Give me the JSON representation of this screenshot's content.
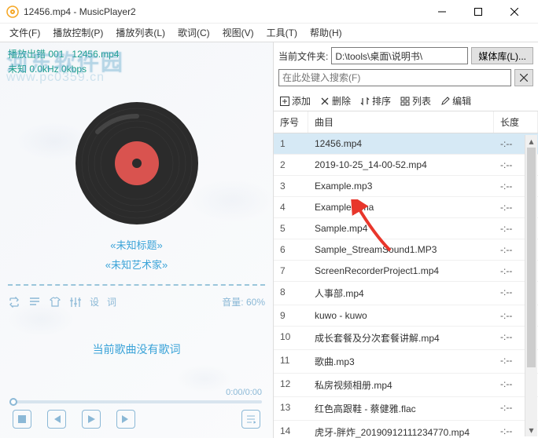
{
  "titlebar": {
    "title": "12456.mp4 - MusicPlayer2"
  },
  "menubar": [
    "文件(F)",
    "播放控制(P)",
    "播放列表(L)",
    "歌词(C)",
    "视图(V)",
    "工具(T)",
    "帮助(H)"
  ],
  "watermark": {
    "main": "河东软件园",
    "url": "www.pc0359.cn"
  },
  "nowplaying": {
    "line1_prefix": "播放出错",
    "line1_num": "001",
    "line1_file": "12456.mp4",
    "line2": "未知 0.0kHz 0kbps"
  },
  "track": {
    "title": "«未知标题»",
    "artist": "«未知艺术家»"
  },
  "controls": {
    "settings_label": "设",
    "lyrics_label": "词",
    "volume_label": "音量:",
    "volume_value": "60%"
  },
  "lyrics_text": "当前歌曲没有歌词",
  "time": {
    "elapsed": "0:00",
    "total": "0:00"
  },
  "right": {
    "current_folder_label": "当前文件夹:",
    "path_value": "D:\\tools\\桌面\\说明书\\",
    "media_lib_btn": "媒体库(L)...",
    "search_placeholder": "在此处键入搜索(F)",
    "toolbar": {
      "add": "添加",
      "delete": "删除",
      "sort": "排序",
      "list": "列表",
      "edit": "编辑"
    },
    "headers": {
      "num": "序号",
      "track": "曲目",
      "len": "长度"
    },
    "rows": [
      {
        "n": "1",
        "t": "12456.mp4",
        "l": "-:--",
        "sel": true
      },
      {
        "n": "2",
        "t": "2019-10-25_14-00-52.mp4",
        "l": "-:--"
      },
      {
        "n": "3",
        "t": "Example.mp3",
        "l": "-:--"
      },
      {
        "n": "4",
        "t": "Example.wma",
        "l": "-:--"
      },
      {
        "n": "5",
        "t": "Sample.mp4",
        "l": "-:--"
      },
      {
        "n": "6",
        "t": "Sample_StreamSound1.MP3",
        "l": "-:--"
      },
      {
        "n": "7",
        "t": "ScreenRecorderProject1.mp4",
        "l": "-:--"
      },
      {
        "n": "8",
        "t": "人事部.mp4",
        "l": "-:--"
      },
      {
        "n": "9",
        "t": "kuwo - kuwo",
        "l": "-:--"
      },
      {
        "n": "10",
        "t": "成长套餐及分次套餐讲解.mp4",
        "l": "-:--"
      },
      {
        "n": "11",
        "t": "歌曲.mp3",
        "l": "-:--"
      },
      {
        "n": "12",
        "t": "私房视频相册.mp4",
        "l": "-:--"
      },
      {
        "n": "13",
        "t": "红色高跟鞋 - 蔡健雅.flac",
        "l": "-:--"
      },
      {
        "n": "14",
        "t": "虎牙-胖炸_20190912111234770.mp4",
        "l": "-:--"
      }
    ]
  }
}
